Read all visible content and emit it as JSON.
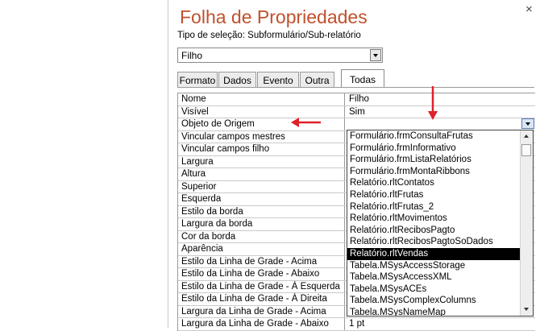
{
  "panel": {
    "title": "Folha de Propriedades",
    "selection_label": "Tipo de seleção:  Subformulário/Sub-relatório",
    "object_combo_value": "Filho",
    "close_glyph": "×"
  },
  "tabs": [
    {
      "label": "Formato",
      "active": false
    },
    {
      "label": "Dados",
      "active": false
    },
    {
      "label": "Evento",
      "active": false
    },
    {
      "label": "Outra",
      "active": false
    },
    {
      "label": "Todas",
      "active": true
    }
  ],
  "properties": [
    {
      "name": "Nome",
      "value": "Filho"
    },
    {
      "name": "Visível",
      "value": "Sim"
    },
    {
      "name": "Objeto de Origem",
      "value": ""
    },
    {
      "name": "Vincular campos mestres",
      "value": ""
    },
    {
      "name": "Vincular campos filho",
      "value": ""
    },
    {
      "name": "Largura",
      "value": ""
    },
    {
      "name": "Altura",
      "value": ""
    },
    {
      "name": "Superior",
      "value": ""
    },
    {
      "name": "Esquerda",
      "value": ""
    },
    {
      "name": "Estilo da borda",
      "value": ""
    },
    {
      "name": "Largura da borda",
      "value": ""
    },
    {
      "name": "Cor da borda",
      "value": ""
    },
    {
      "name": "Aparência",
      "value": ""
    },
    {
      "name": "Estilo da Linha de Grade - Acima",
      "value": ""
    },
    {
      "name": "Estilo da Linha de Grade - Abaixo",
      "value": ""
    },
    {
      "name": "Estilo da Linha de Grade - À Esquerda",
      "value": ""
    },
    {
      "name": "Estilo da Linha de Grade - À Direita",
      "value": ""
    },
    {
      "name": "Largura da Linha de Grade - Acima",
      "value": ""
    },
    {
      "name": "Largura da Linha de Grade - Abaixo",
      "value": "1 pt"
    }
  ],
  "source_dropdown": {
    "selected": "Relatório.rltVendas",
    "items": [
      "Formulário.frmConsultaFrutas",
      "Formulário.frmInformativo",
      "Formulário.frmListaRelatórios",
      "Formulário.frmMontaRibbons",
      "Relatório.rltContatos",
      "Relatório.rltFrutas",
      "Relatório.rltFrutas_2",
      "Relatório.rltMovimentos",
      "Relatório.rltRecibosPagto",
      "Relatório.rltRecibosPagtoSoDados",
      "Relatório.rltVendas",
      "Tabela.MSysAccessStorage",
      "Tabela.MSysAccessXML",
      "Tabela.MSysACEs",
      "Tabela.MSysComplexColumns",
      "Tabela.MSysNameMap"
    ]
  },
  "colors": {
    "title": "#c1502c",
    "annotation_arrow": "#e0202a",
    "selected_item_bg": "#000000"
  }
}
